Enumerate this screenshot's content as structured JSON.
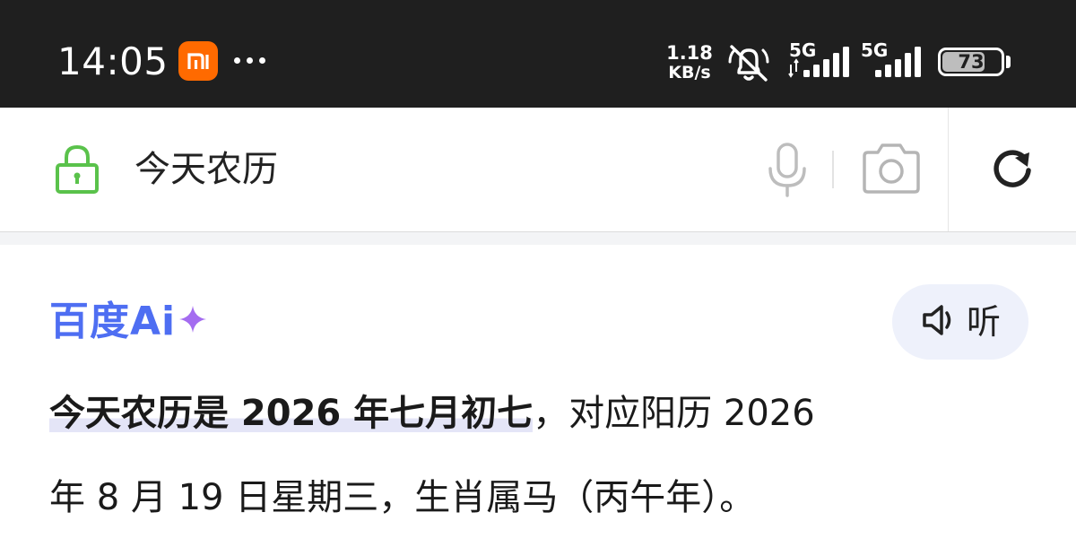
{
  "status_bar": {
    "time": "14:05",
    "app_badge": "mi",
    "net_speed_value": "1.18",
    "net_speed_unit": "KB/s",
    "signal_1_label": "5G",
    "signal_2_label": "5G",
    "battery_level": "73",
    "battery_fraction": 0.73,
    "icons": [
      "xiaomi-icon",
      "more-dots-icon",
      "mute-bell-icon",
      "signal-icon",
      "battery-icon"
    ]
  },
  "search": {
    "query": "今天农历",
    "icons": [
      "lock-icon",
      "mic-icon",
      "camera-icon",
      "refresh-icon"
    ]
  },
  "answer_card": {
    "brand": "百度Ai",
    "brand_icon": "sparkle-icon",
    "listen_label": "听",
    "listen_icon": "speaker-icon",
    "highlight": "今天农历是 2026 年七月初七",
    "line1_rest": "，对应阳历 2026",
    "line2": "年 8 月 19 日星期三，生肖属马（丙午年）。"
  },
  "colors": {
    "status_bar_bg": "#1f1f1f",
    "mi_orange": "#ff6a00",
    "lock_green": "#5ac24b",
    "brand_blue": "#4e6ef2",
    "sparkle_purple": "#a46cf0",
    "highlight_bg": "#e4e5f7",
    "listen_bg": "#eef1fb"
  }
}
